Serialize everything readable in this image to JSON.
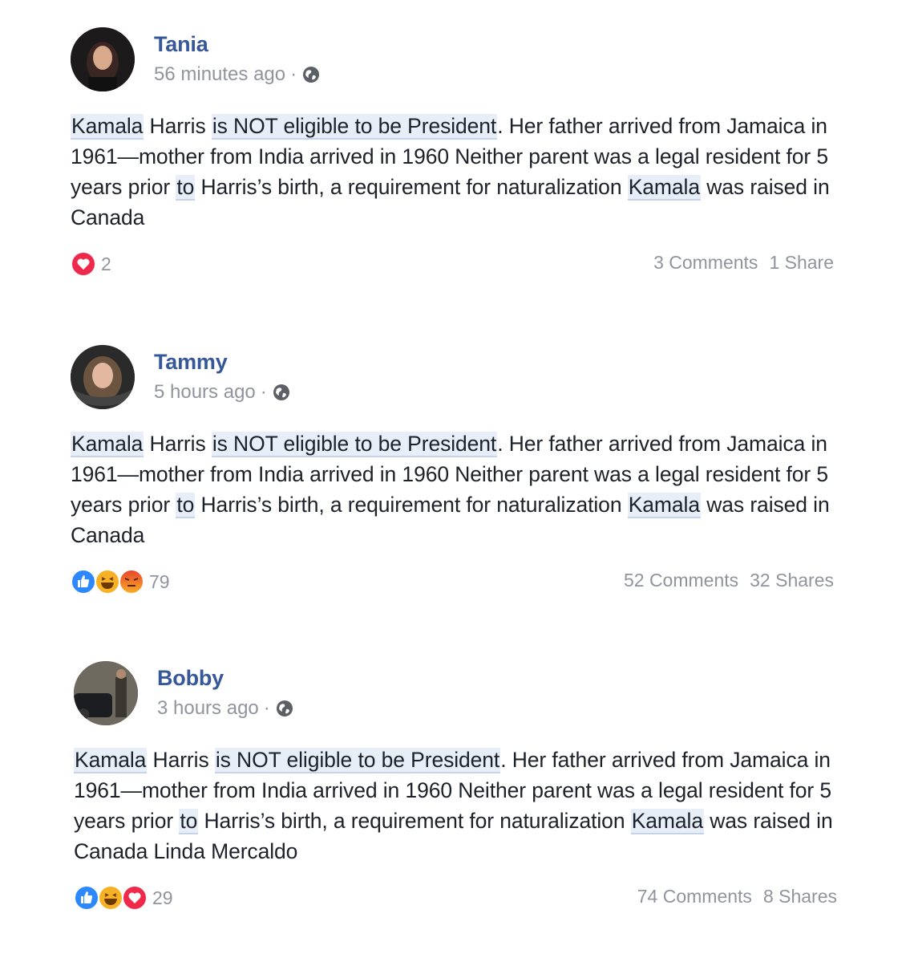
{
  "posts": [
    {
      "author": "Tania",
      "time": "56 minutes ago",
      "separator": "·",
      "privacy_icon": "globe-icon",
      "text": {
        "s1": "Kamala",
        "s2": " Harris ",
        "s3": "is NOT eligible to be President",
        "s4": ". Her father arrived from Jamaica in 1961—mother from India arrived in 1960 Neither parent was a legal resident for 5 years prior ",
        "s5": "to",
        "s6": " Harris’s birth, a requirement for naturalization ",
        "s7": "Kamala",
        "s8": " was raised in Canada"
      },
      "reactions": [
        "love-icon"
      ],
      "reaction_count": "2",
      "comments": "3 Comments",
      "shares": "1 Share"
    },
    {
      "author": "Tammy",
      "time": "5 hours ago",
      "separator": "·",
      "privacy_icon": "globe-icon",
      "text": {
        "s1": "Kamala",
        "s2": " Harris ",
        "s3": "is NOT eligible to be President",
        "s4": ". Her father arrived from Jamaica in 1961—mother from India arrived in 1960 Neither parent was a legal resident for 5 years prior ",
        "s5": "to",
        "s6": " Harris’s birth, a requirement for naturalization ",
        "s7": "Kamala",
        "s8": " was raised in Canada"
      },
      "reactions": [
        "like-icon",
        "haha-icon",
        "angry-icon"
      ],
      "reaction_count": "79",
      "comments": "52 Comments",
      "shares": "32 Shares"
    },
    {
      "author": "Bobby",
      "time": "3 hours ago",
      "separator": "·",
      "privacy_icon": "globe-icon",
      "text": {
        "s1": "Kamala",
        "s2": " Harris ",
        "s3": "is NOT eligible to be President",
        "s4": ". Her father arrived from Jamaica in 1961—mother from India arrived in 1960 Neither parent was a legal resident for 5 years prior ",
        "s5": "to",
        "s6": " Harris’s birth, a requirement for naturalization ",
        "s7": "Kamala",
        "s8": " was raised in Canada Linda Mercaldo"
      },
      "reactions": [
        "like-icon",
        "haha-icon",
        "love-icon"
      ],
      "reaction_count": "29",
      "comments": "74 Comments",
      "shares": "8 Shares"
    }
  ],
  "colors": {
    "name": "#365899",
    "meta": "#90949c",
    "highlight": "#e8eef8",
    "like": "#2d88ff",
    "love": "#f0284a",
    "haha": "#f7b125",
    "angry": "#e9710f"
  }
}
